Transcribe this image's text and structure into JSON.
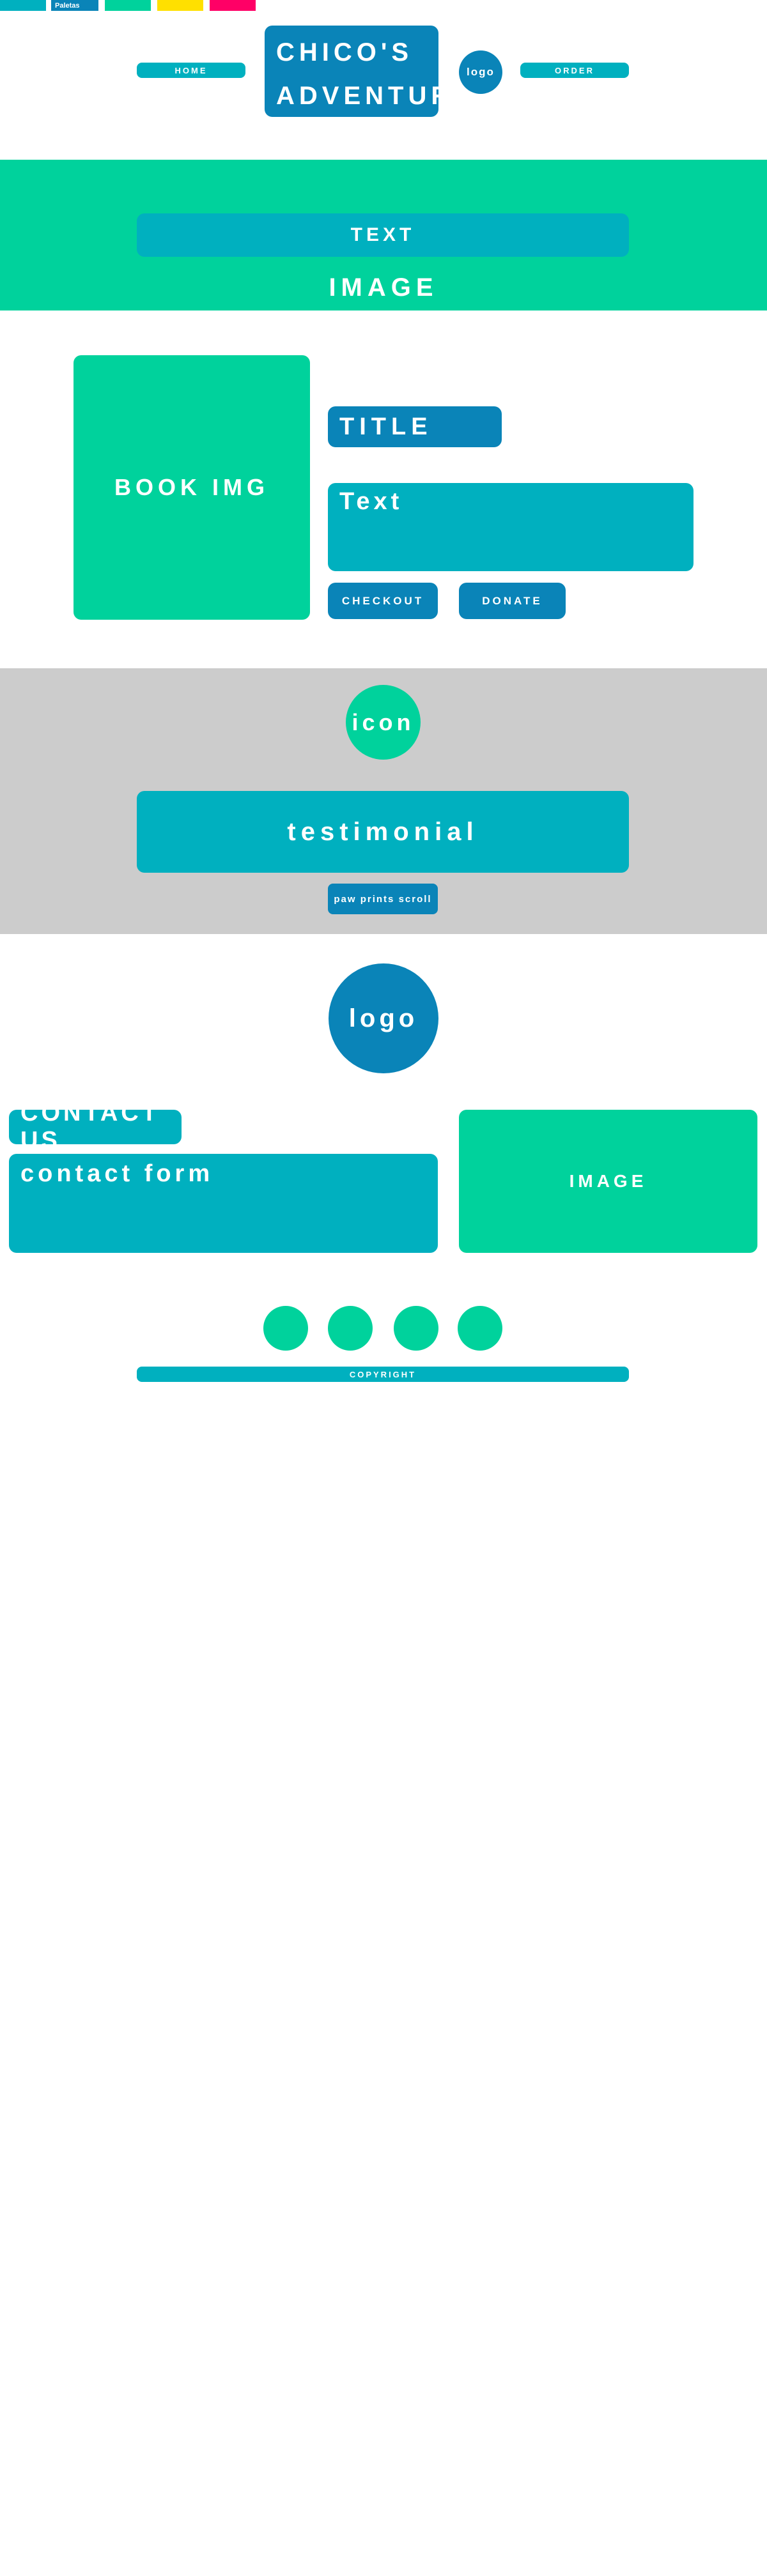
{
  "palette": {
    "swatches": [
      {
        "color": "#00b0bf",
        "label": ""
      },
      {
        "color": "#0a84b8",
        "label": "Paletas"
      },
      {
        "color": "#00d29c",
        "label": ""
      },
      {
        "color": "#ffe000",
        "label": ""
      },
      {
        "color": "#ff0066",
        "label": ""
      }
    ]
  },
  "colors": {
    "teal": "#00b0bf",
    "blue": "#0a84b8",
    "green": "#00d29c",
    "gray": "#cccccc",
    "white": "#ffffff"
  },
  "header": {
    "nav_home": "HOME",
    "site_title_line1": "CHICO'S",
    "site_title_line2": "ADVENTURES",
    "logo": "logo",
    "nav_order": "ORDER"
  },
  "hero": {
    "text": "TEXT",
    "image": "IMAGE"
  },
  "featured": {
    "book_image": "BOOK IMG",
    "title": "TITLE",
    "text": "Text",
    "checkout_label": "CHECKOUT",
    "donate_label": "DONATE"
  },
  "testimonials": {
    "icon": "icon",
    "testimonial": "testimonial",
    "scroll_label": "paw prints scroll"
  },
  "brand": {
    "logo": "logo"
  },
  "contact": {
    "heading": "CONTACT US",
    "form": "contact form",
    "image": "IMAGE"
  },
  "footer": {
    "copyright": "COPYRIGHT"
  }
}
